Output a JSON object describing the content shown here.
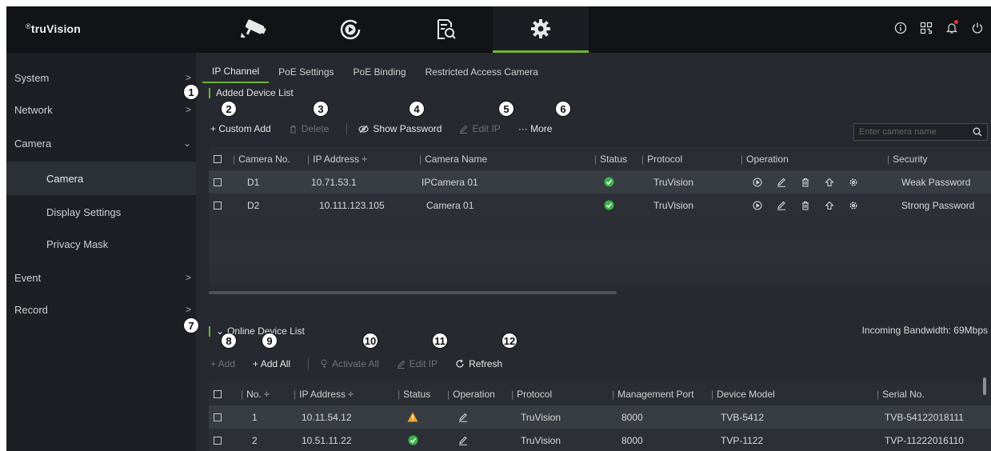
{
  "brand": {
    "reg": "®",
    "name": "truVision"
  },
  "nav": {
    "tabs": [
      {
        "name": "camera-live-view-tab",
        "icon": "security-camera-icon"
      },
      {
        "name": "playback-tab",
        "icon": "playback-icon"
      },
      {
        "name": "search-tab",
        "icon": "file-search-icon"
      },
      {
        "name": "settings-tab",
        "icon": "gear-icon",
        "active": true
      }
    ],
    "right_icons": [
      "info-icon",
      "qr-code-icon",
      "bell-icon",
      "power-icon"
    ]
  },
  "sidebar": {
    "items": [
      {
        "label": "System",
        "chevron": ">"
      },
      {
        "label": "Network",
        "chevron": ">"
      },
      {
        "label": "Camera",
        "chevron": "⌄"
      },
      {
        "label": "Camera",
        "sub": true,
        "selected": true
      },
      {
        "label": "Display Settings",
        "sub": true
      },
      {
        "label": "Privacy Mask",
        "sub": true
      },
      {
        "label": "Event",
        "chevron": ">"
      },
      {
        "label": "Record",
        "chevron": ">"
      }
    ]
  },
  "subtabs": [
    "IP Channel",
    "PoE Settings",
    "PoE Binding",
    "Restricted Access Camera"
  ],
  "added": {
    "title": "Added Device List",
    "toolbar": {
      "custom_add": "+ Custom Add",
      "delete": "Delete",
      "show_password": "Show Password",
      "edit_ip": "Edit IP",
      "more": "··· More"
    },
    "search_placeholder": "Enter camera name",
    "headers": [
      "Camera No.",
      "IP Address ÷",
      "Camera Name",
      "Status",
      "Protocol",
      "Operation",
      "Security"
    ],
    "rows": [
      {
        "no": "D1",
        "ip": "10.71.53.1",
        "name": "IPCamera 01",
        "status": "ok",
        "protocol": "TruVision",
        "security": "Weak Password"
      },
      {
        "no": "D2",
        "ip": "10.111.123.105",
        "name": "Camera 01",
        "status": "ok",
        "protocol": "TruVision",
        "security": "Strong Password"
      }
    ]
  },
  "online": {
    "title": "Online Device List",
    "bandwidth": "Incoming Bandwidth: 69Mbps",
    "toolbar": {
      "add": "+ Add",
      "add_all": "+ Add All",
      "activate_all": "Activate All",
      "edit_ip": "Edit IP",
      "refresh": "Refresh"
    },
    "headers": [
      "No. ÷",
      "IP Address ÷",
      "Status",
      "Operation",
      "Protocol",
      "Management Port",
      "Device Model",
      "Serial No."
    ],
    "rows": [
      {
        "no": "1",
        "ip": "10.11.54.12",
        "status": "warning",
        "protocol": "TruVision",
        "port": "8000",
        "model": "TVB-5412",
        "serial": "TVB-54122018111"
      },
      {
        "no": "2",
        "ip": "10.51.11.22",
        "status": "ok",
        "protocol": "TruVision",
        "port": "8000",
        "model": "TVP-1122",
        "serial": "TVP-11222016110"
      }
    ]
  },
  "callouts": [
    "1",
    "2",
    "3",
    "4",
    "5",
    "6",
    "7",
    "8",
    "9",
    "10",
    "11",
    "12"
  ],
  "colors": {
    "accent": "#6fb43a",
    "ok": "#3bb54a",
    "warning": "#f0a020"
  }
}
